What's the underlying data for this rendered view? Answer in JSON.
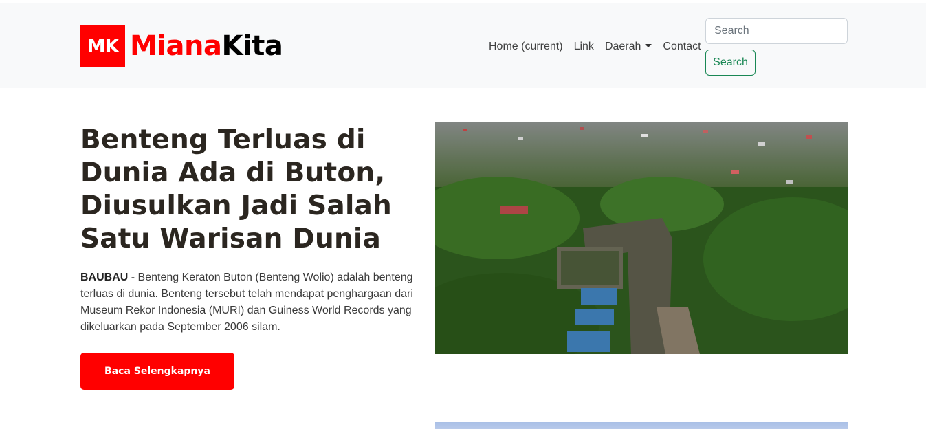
{
  "brand": {
    "mark": "MK",
    "name_part1": "Miana",
    "name_part2": "Kita"
  },
  "nav": {
    "items": [
      {
        "label": "Home (current)"
      },
      {
        "label": "Link"
      },
      {
        "label": "Daerah"
      },
      {
        "label": "Contact"
      }
    ]
  },
  "search": {
    "placeholder": "Search",
    "button_label": "Search"
  },
  "article": {
    "title": "Benteng Terluas di Dunia Ada di Buton, Diusulkan Jadi Salah Satu Warisan Dunia",
    "dateline": "BAUBAU",
    "lead": " - Benteng Keraton Buton (Benteng Wolio) adalah benteng terluas di dunia. Benteng tersebut telah mendapat penghargaan dari Museum Rekor Indonesia (MURI) dan Guiness World Records yang dikeluarkan pada September 2006 silam.",
    "cta_label": "Baca Selengkapnya"
  },
  "colors": {
    "brand_red": "#ff0000",
    "search_green": "#198754",
    "navbar_bg": "#f8f9fa"
  }
}
